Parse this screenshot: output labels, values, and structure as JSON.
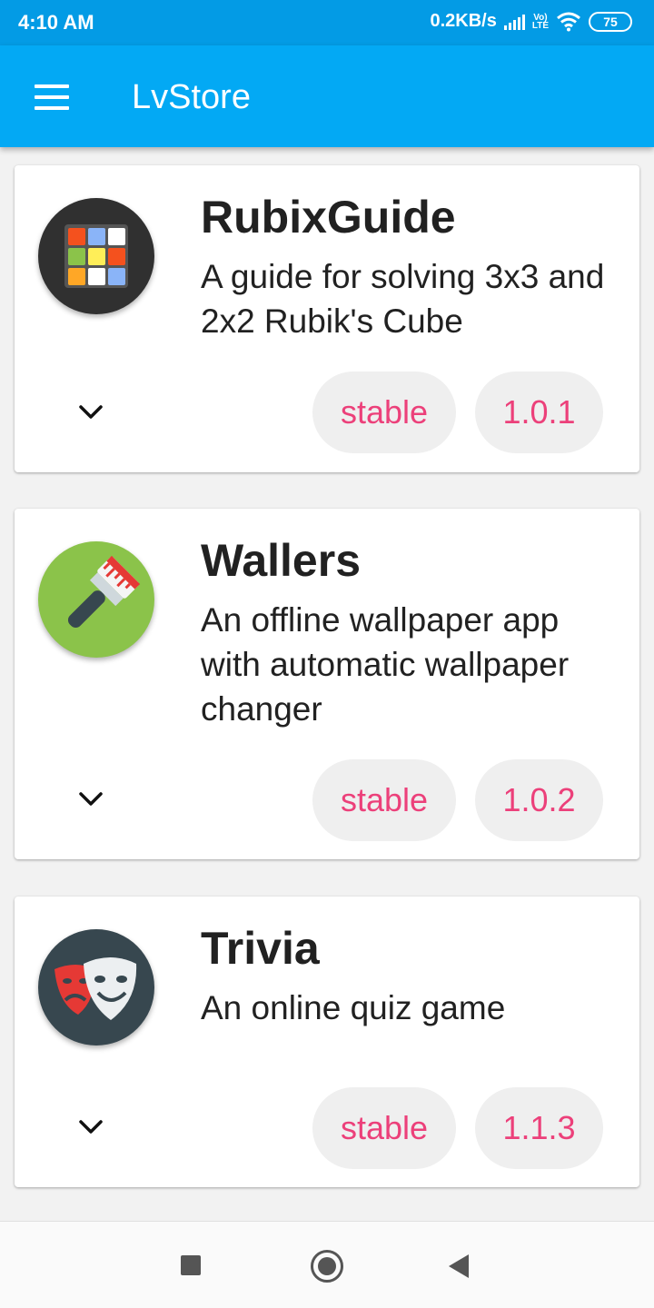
{
  "status_bar": {
    "time": "4:10 AM",
    "network_speed": "0.2KB/s",
    "volte_label_top": "Vo)",
    "volte_label_bottom": "LTE",
    "battery": "75",
    "icons": [
      "signal-icon",
      "volte-icon",
      "wifi-icon",
      "battery-icon"
    ]
  },
  "app_bar": {
    "title": "LvStore",
    "menu_icon": "menu-icon"
  },
  "apps": [
    {
      "name": "RubixGuide",
      "description": "A guide for solving 3x3 and 2x2 Rubik's Cube",
      "status": "stable",
      "version": "1.0.1",
      "icon": "rubiks-cube-icon",
      "icon_color": "#303030"
    },
    {
      "name": "Wallers",
      "description": "An offline wallpaper app with automatic wallpaper changer",
      "status": "stable",
      "version": "1.0.2",
      "icon": "paintbrush-icon",
      "icon_color": "#8bc34a"
    },
    {
      "name": "Trivia",
      "description": "An online quiz game",
      "status": "stable",
      "version": "1.1.3",
      "icon": "theater-masks-icon",
      "icon_color": "#37474f"
    }
  ],
  "colors": {
    "primary": "#03a9f4",
    "primary_dark": "#039be5",
    "chip_text": "#ec407a",
    "chip_bg": "#efefef"
  },
  "nav_bar": {
    "buttons": [
      "recent-apps-button",
      "home-button",
      "back-button"
    ]
  }
}
